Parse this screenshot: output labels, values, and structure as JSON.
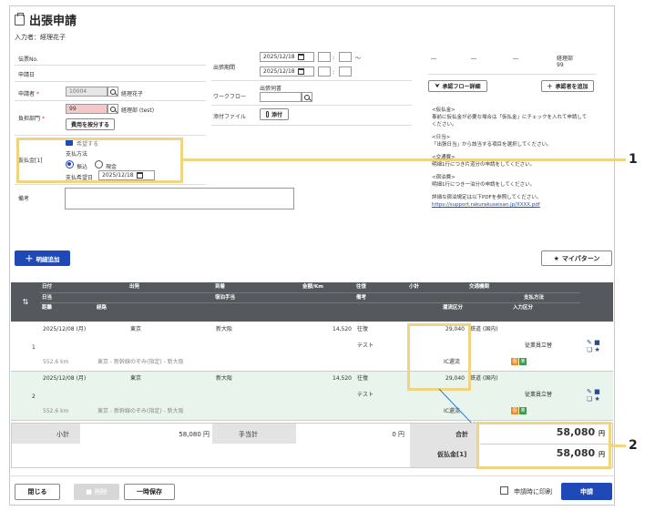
{
  "page": {
    "title": "出張申請",
    "entry_by": "入力者：経理花子"
  },
  "form": {
    "slip_no_label": "伝票No.",
    "apply_date_label": "申請日",
    "applicant_label": "申請者",
    "applicant_code": "10004",
    "applicant_name": "経理花子",
    "dept_label": "負担部門",
    "dept_code": "99",
    "dept_name": "経理部 (test)",
    "split_cost_button": "費用を按分する",
    "advance_label": "仮払金[1]",
    "advance_hope": "希望する",
    "payment_method_label": "支払方法",
    "payment_transfer": "振込",
    "payment_cash": "現金",
    "payment_date_label": "支払希望日",
    "payment_date": "2025/12/18",
    "remarks_label": "備考",
    "period_label": "出張期間",
    "period_start": "2025/12/18",
    "period_end": "2025/12/18",
    "tilde": "～",
    "workflow_label": "ワークフロー",
    "workflow_sub": "出張伺書",
    "attachment_label": "添付ファイル",
    "attach_button": "添付"
  },
  "approval": {
    "cols": [
      "―",
      "―",
      "―",
      "経理部"
    ],
    "last_code": "99",
    "flow_detail_button": "承認フロー詳細",
    "add_approver_button": "承認者を追加"
  },
  "info": {
    "p1_title": "<仮払金>",
    "p1_body": "事前に仮払金が必要な場合は「仮払金」にチェックを入れて申請してください。",
    "p2_title": "<日当>",
    "p2_body": "「出張日当」から該当する項目を選択してください。",
    "p3_title": "<交通費>",
    "p3_body": "明細1行につき片道分の申請をしてください。",
    "p4_title": "<宿泊費>",
    "p4_body": "明細1行につき一泊分の申請をしてください。",
    "p5_body": "詳細な宿泊規定は以下PDFを参照してください。",
    "link": "https://support.rakurakuseisan.jp/XXXX.pdf"
  },
  "toolbar": {
    "add_detail": "明細追加",
    "my_pattern": "マイパターン"
  },
  "table": {
    "header1": [
      "日付",
      "出発",
      "到着",
      "金額/Km",
      "往復",
      "小計",
      "交通機関"
    ],
    "header2": [
      "日当",
      "宿泊手当",
      "備考",
      "支払方法"
    ],
    "header3": [
      "距離",
      "経路",
      "還流区分",
      "入力区分"
    ],
    "rows": [
      {
        "no": "1",
        "date": "2025/12/08 (月)",
        "from": "東京",
        "to": "新大阪",
        "amount": "14,520",
        "roundtrip": "往復",
        "subtotal": "29,040",
        "transport": "鉄道 (国内)",
        "memo": "テスト",
        "payment": "従業員立替",
        "distance": "552.6 km",
        "route": "東京 - 新幹線のぞみ(指定) - 新大阪",
        "ic": "IC還流"
      },
      {
        "no": "2",
        "date": "2025/12/08 (月)",
        "from": "東京",
        "to": "新大阪",
        "amount": "14,520",
        "roundtrip": "往復",
        "subtotal": "29,040",
        "transport": "鉄道 (国内)",
        "memo": "テスト",
        "payment": "従業員立替",
        "distance": "552.6 km",
        "route": "東京 - 新幹線のぞみ(指定) - 新大阪",
        "ic": "IC還流"
      }
    ]
  },
  "summary": {
    "subtotal_label": "小計",
    "subtotal_value": "58,080 円",
    "allowance_label": "手当計",
    "allowance_value": "0 円",
    "total_label": "合計",
    "total_value": "58,080",
    "advance_label": "仮払金[1]",
    "advance_value": "58,080",
    "yen": "円"
  },
  "footer": {
    "close": "閉じる",
    "delete": "削除",
    "save": "一時保存",
    "print_on_apply": "申請時に印刷",
    "apply": "申請"
  },
  "callouts": {
    "one": "1",
    "two": "2"
  },
  "colors": {
    "accent": "#1e49b7",
    "highlight": "#f1d480",
    "header": "#55595d",
    "row_green": "#e9f4ec"
  }
}
